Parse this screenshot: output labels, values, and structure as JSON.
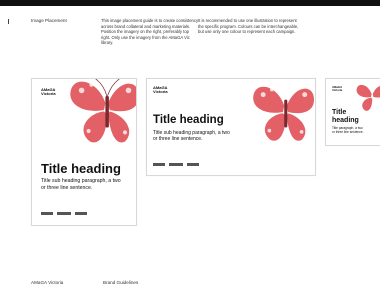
{
  "header": {
    "label": "Image Placement",
    "col1": "This image placement guide is to create consistency across brand collateral and marketing materials. Position the imagery on the right, preferably top right. Only use the imagery from the AMaGA Vic library.",
    "col2": "It is recommended to use one illustration to represent the specific program. Colours can be interchangeable, but use only one colour to represent each campaign."
  },
  "card_a": {
    "logo_line1": "AMaGA",
    "logo_line2": "Victoria",
    "heading": "Title heading",
    "sub": "Title sub heading paragraph, a two or three line sentence."
  },
  "card_b": {
    "logo_line1": "AMaGA",
    "logo_line2": "Victoria",
    "heading": "Title heading",
    "sub": "Title sub heading paragraph, a two or three line sentence."
  },
  "card_c": {
    "logo_line1": "AMaGA",
    "logo_line2": "Victoria",
    "heading": "Title heading",
    "sub": "Title paragraph, a two or three line sentence."
  },
  "footer": {
    "left": "AMaGA Victoria",
    "right": "Brand Guidelines"
  },
  "colors": {
    "accent_red": "#e0535a",
    "topbar": "#111111"
  },
  "icons": {
    "illustration": "butterfly-illustration-icon",
    "partners": "partner-logos-icon"
  }
}
